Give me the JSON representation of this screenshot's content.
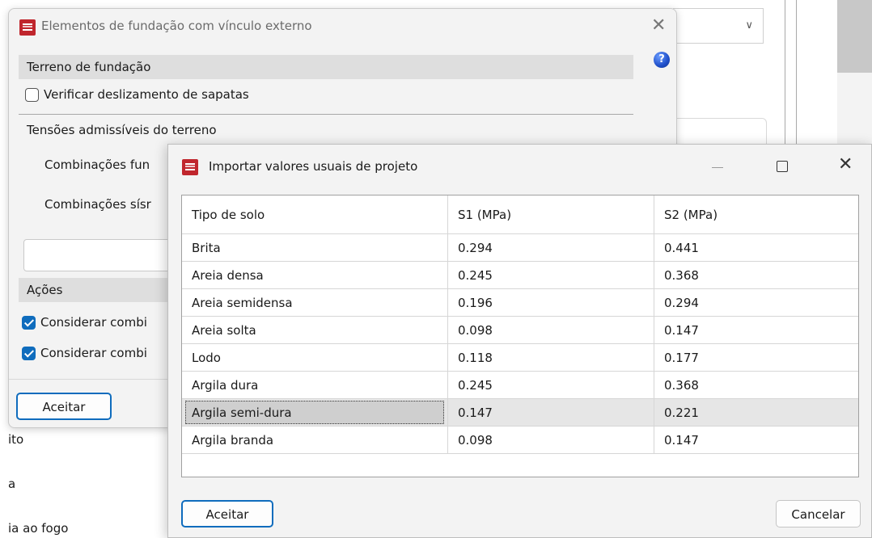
{
  "background": {
    "left_texts": [
      "ito",
      "a",
      "ia ao fogo"
    ]
  },
  "dialog_main": {
    "title": "Elementos de fundação com vínculo externo",
    "section_terreno": "Terreno de fundação",
    "check_deslizamento": {
      "label": "Verificar deslizamento de sapatas",
      "checked": false
    },
    "section_tensoes": "Tensões admissíveis do terreno",
    "label_fundamentais": "Combinações fun",
    "label_sismicas": "Combinações sísr",
    "section_acoes": "Ações",
    "check_comb1": {
      "label": "Considerar combi",
      "checked": true
    },
    "check_comb2": {
      "label": "Considerar combi",
      "checked": true
    },
    "accept_label": "Aceitar"
  },
  "dialog_import": {
    "title": "Importar valores usuais de projeto",
    "columns": [
      "Tipo de solo",
      "S1 (MPa)",
      "S2 (MPa)"
    ],
    "rows": [
      [
        "Brita",
        "0.294",
        "0.441"
      ],
      [
        "Areia densa",
        "0.245",
        "0.368"
      ],
      [
        "Areia semidensa",
        "0.196",
        "0.294"
      ],
      [
        "Areia solta",
        "0.098",
        "0.147"
      ],
      [
        "Lodo",
        "0.118",
        "0.177"
      ],
      [
        "Argila dura",
        "0.245",
        "0.368"
      ],
      [
        "Argila semi-dura",
        "0.147",
        "0.221"
      ],
      [
        "Argila branda",
        "0.098",
        "0.147"
      ]
    ],
    "selected_row": 6,
    "accept_label": "Aceitar",
    "cancel_label": "Cancelar"
  },
  "colors": {
    "accent": "#0f6cbd",
    "app_icon": "#c0262d",
    "selection": "#e6e6e6"
  }
}
